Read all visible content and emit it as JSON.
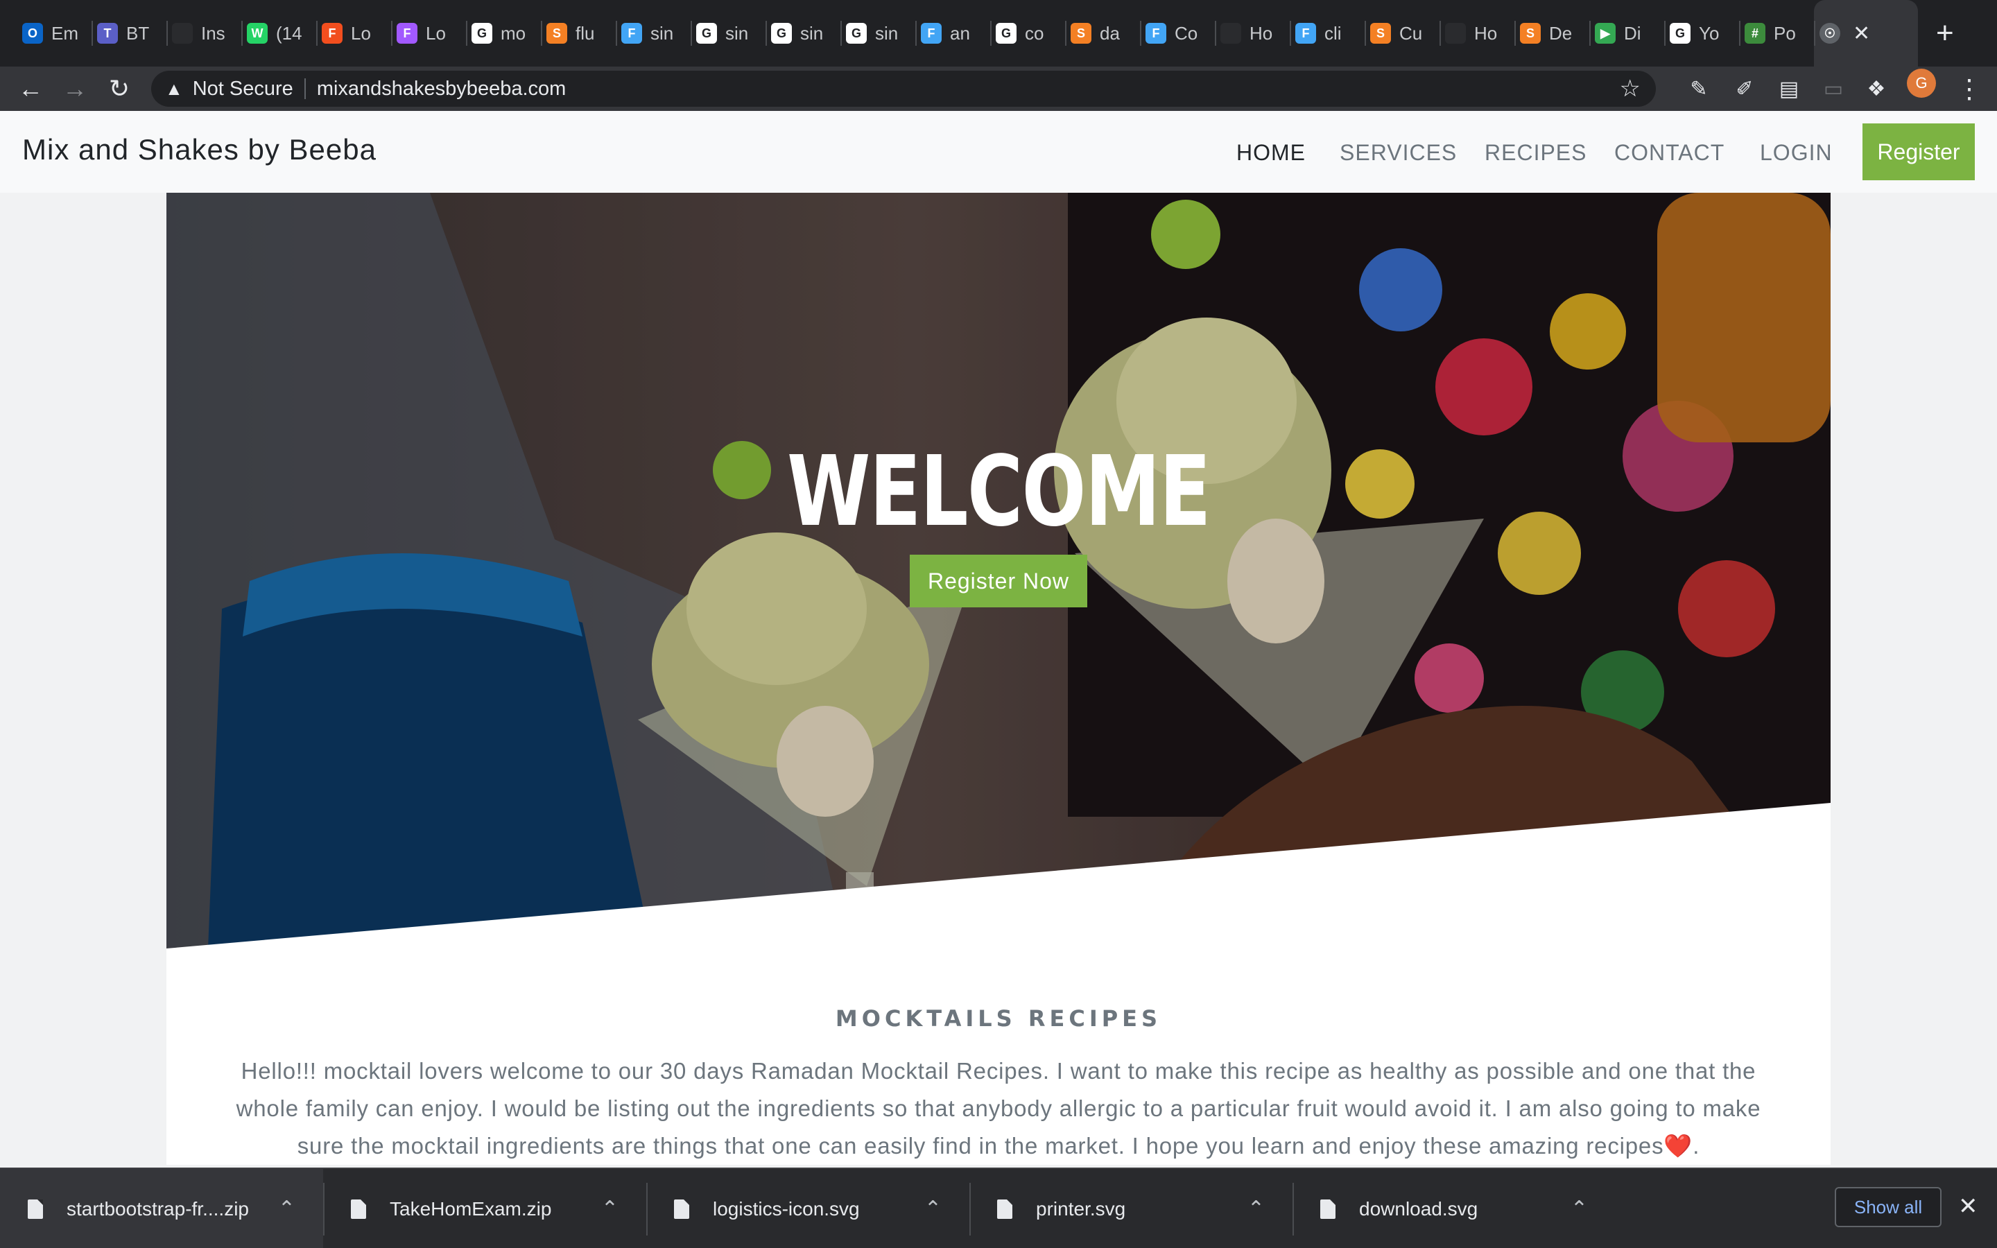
{
  "browser": {
    "tabs": [
      {
        "label": "Em",
        "icon": "outlook-icon",
        "color": "#0a64c7",
        "glyph": "O"
      },
      {
        "label": "BT",
        "icon": "teams-icon",
        "color": "#5b5fc7",
        "glyph": "T"
      },
      {
        "label": "Ins",
        "icon": "dark-app-icon",
        "color": "#2a2b2e",
        "glyph": ""
      },
      {
        "label": "(14",
        "icon": "whatsapp-icon",
        "color": "#25d366",
        "glyph": "W"
      },
      {
        "label": "Lo",
        "icon": "figma-icon",
        "color": "#f24e1e",
        "glyph": "F"
      },
      {
        "label": "Lo",
        "icon": "figma-icon",
        "color": "#a259ff",
        "glyph": "F"
      },
      {
        "label": "mo",
        "icon": "google-icon",
        "color": "#ffffff",
        "glyph": "G"
      },
      {
        "label": "flu",
        "icon": "stackoverflow-icon",
        "color": "#f48024",
        "glyph": "S"
      },
      {
        "label": "sin",
        "icon": "flutter-icon",
        "color": "#42a5f5",
        "glyph": "F"
      },
      {
        "label": "sin",
        "icon": "github-icon",
        "color": "#ffffff",
        "glyph": "G"
      },
      {
        "label": "sin",
        "icon": "github-icon",
        "color": "#ffffff",
        "glyph": "G"
      },
      {
        "label": "sin",
        "icon": "github-icon",
        "color": "#ffffff",
        "glyph": "G"
      },
      {
        "label": "an",
        "icon": "flutter-icon",
        "color": "#42a5f5",
        "glyph": "F"
      },
      {
        "label": "co",
        "icon": "google-icon",
        "color": "#ffffff",
        "glyph": "G"
      },
      {
        "label": "da",
        "icon": "stackoverflow-icon",
        "color": "#f48024",
        "glyph": "S"
      },
      {
        "label": "Co",
        "icon": "flutter-icon",
        "color": "#42a5f5",
        "glyph": "F"
      },
      {
        "label": "Ho",
        "icon": "dark-app-icon",
        "color": "#2a2b2e",
        "glyph": ""
      },
      {
        "label": "cli",
        "icon": "flutter-icon",
        "color": "#42a5f5",
        "glyph": "F"
      },
      {
        "label": "Cu",
        "icon": "stackoverflow-icon",
        "color": "#f48024",
        "glyph": "S"
      },
      {
        "label": "Ho",
        "icon": "dark-app-icon",
        "color": "#2a2b2e",
        "glyph": ""
      },
      {
        "label": "De",
        "icon": "stackoverflow-icon",
        "color": "#f48024",
        "glyph": "S"
      },
      {
        "label": "Di",
        "icon": "google-play-icon",
        "color": "#34a853",
        "glyph": "▶"
      },
      {
        "label": "Yo",
        "icon": "github-icon",
        "color": "#ffffff",
        "glyph": "G"
      },
      {
        "label": "Po",
        "icon": "hash-icon",
        "color": "#3c8b3c",
        "glyph": "#"
      }
    ],
    "address": {
      "security_label": "Not Secure",
      "url": "mixandshakesbybeeba.com"
    },
    "profile_initial": "G"
  },
  "site": {
    "brand": "Mix and Shakes by Beeba",
    "nav": {
      "home": "HOME",
      "services": "SERVICES",
      "recipes": "RECIPES",
      "contact": "CONTACT",
      "login": "LOGIN",
      "register": "Register"
    },
    "hero": {
      "heading": "WELCOME",
      "cta": "Register Now"
    },
    "section": {
      "title": "MOCKTAILS RECIPES",
      "intro": "Hello!!! mocktail lovers welcome to our 30 days Ramadan Mocktail Recipes. I want to make this recipe as healthy as possible and one that the whole family can enjoy. I would be listing out the ingredients so that anybody allergic to a particular fruit would avoid it. I am also going to make sure the mocktail ingredients are things that one can easily find in the market. I hope you learn and enjoy these amazing recipes❤️."
    },
    "accent_color": "#7cb342"
  },
  "downloads": {
    "items": [
      {
        "name": "startbootstrap-fr....zip"
      },
      {
        "name": "TakeHomExam.zip"
      },
      {
        "name": "logistics-icon.svg"
      },
      {
        "name": "printer.svg"
      },
      {
        "name": "download.svg"
      }
    ],
    "show_all": "Show all"
  }
}
